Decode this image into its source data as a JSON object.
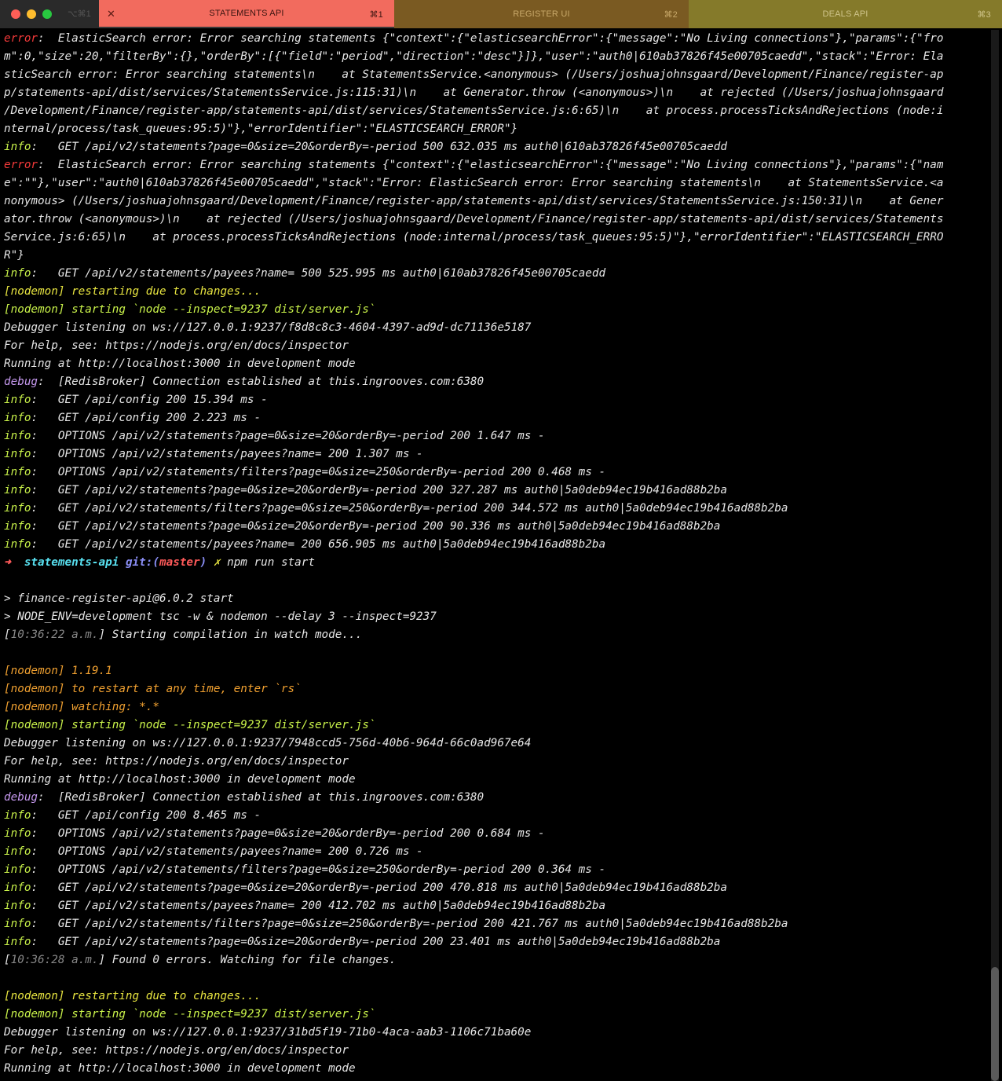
{
  "window": {
    "ghost_label": "⌥⌘1"
  },
  "tabs": [
    {
      "label": "STATEMENTS API",
      "shortcut": "⌘1",
      "active": true
    },
    {
      "label": "REGISTER UI",
      "shortcut": "⌘2",
      "active": false
    },
    {
      "label": "DEALS API",
      "shortcut": "⌘3",
      "active": false
    }
  ],
  "colors": {
    "tab1": "#f26b5e",
    "tab2": "#7a5a22",
    "tab3": "#857a2a",
    "info": "#c9f24a",
    "error": "#f53a3a",
    "debug": "#c79af0",
    "nodemon": "#e8e540"
  },
  "lines": [
    [
      [
        "r",
        "error"
      ],
      [
        "w",
        ":  ElasticSearch error: Error searching statements {\"context\":{\"elasticsearchError\":{\"message\":\"No Living connections\"},\"params\":{\"fro"
      ]
    ],
    [
      [
        "w",
        "m\":0,\"size\":20,\"filterBy\":{},\"orderBy\":[{\"field\":\"period\",\"direction\":\"desc\"}]},\"user\":\"auth0|610ab37826f45e00705caedd\",\"stack\":\"Error: Ela"
      ]
    ],
    [
      [
        "w",
        "sticSearch error: Error searching statements\\n    at StatementsService.<anonymous> (/Users/joshuajohnsgaard/Development/Finance/register-ap"
      ]
    ],
    [
      [
        "w",
        "p/statements-api/dist/services/StatementsService.js:115:31)\\n    at Generator.throw (<anonymous>)\\n    at rejected (/Users/joshuajohnsgaard"
      ]
    ],
    [
      [
        "w",
        "/Development/Finance/register-app/statements-api/dist/services/StatementsService.js:6:65)\\n    at process.processTicksAndRejections (node:i"
      ]
    ],
    [
      [
        "w",
        "nternal/process/task_queues:95:5)\"},\"errorIdentifier\":\"ELASTICSEARCH_ERROR\"}"
      ]
    ],
    [
      [
        "g",
        "info"
      ],
      [
        "w",
        ":   GET /api/v2/statements?page=0&size=20&orderBy=-period 500 632.035 ms auth0|610ab37826f45e00705caedd"
      ]
    ],
    [
      [
        "r",
        "error"
      ],
      [
        "w",
        ":  ElasticSearch error: Error searching statements {\"context\":{\"elasticsearchError\":{\"message\":\"No Living connections\"},\"params\":{\"nam"
      ]
    ],
    [
      [
        "w",
        "e\":\"\"},\"user\":\"auth0|610ab37826f45e00705caedd\",\"stack\":\"Error: ElasticSearch error: Error searching statements\\n    at StatementsService.<a"
      ]
    ],
    [
      [
        "w",
        "nonymous> (/Users/joshuajohnsgaard/Development/Finance/register-app/statements-api/dist/services/StatementsService.js:150:31)\\n    at Gener"
      ]
    ],
    [
      [
        "w",
        "ator.throw (<anonymous>)\\n    at rejected (/Users/joshuajohnsgaard/Development/Finance/register-app/statements-api/dist/services/Statements"
      ]
    ],
    [
      [
        "w",
        "Service.js:6:65)\\n    at process.processTicksAndRejections (node:internal/process/task_queues:95:5)\"},\"errorIdentifier\":\"ELASTICSEARCH_ERRO"
      ]
    ],
    [
      [
        "w",
        "R\"}"
      ]
    ],
    [
      [
        "g",
        "info"
      ],
      [
        "w",
        ":   GET /api/v2/statements/payees?name= 500 525.995 ms auth0|610ab37826f45e00705caedd"
      ]
    ],
    [
      [
        "y",
        "[nodemon] restarting due to changes..."
      ]
    ],
    [
      [
        "g",
        "[nodemon] starting `node --inspect=9237 dist/server.js`"
      ]
    ],
    [
      [
        "w",
        "Debugger listening on ws://127.0.0.1:9237/f8d8c8c3-4604-4397-ad9d-dc71136e5187"
      ]
    ],
    [
      [
        "w",
        "For help, see: https://nodejs.org/en/docs/inspector"
      ]
    ],
    [
      [
        "w",
        "Running at http://localhost:3000 in development mode"
      ]
    ],
    [
      [
        "m",
        "debug"
      ],
      [
        "w",
        ":  [RedisBroker] Connection established at this.ingrooves.com:6380"
      ]
    ],
    [
      [
        "g",
        "info"
      ],
      [
        "w",
        ":   GET /api/config 200 15.394 ms -"
      ]
    ],
    [
      [
        "g",
        "info"
      ],
      [
        "w",
        ":   GET /api/config 200 2.223 ms -"
      ]
    ],
    [
      [
        "g",
        "info"
      ],
      [
        "w",
        ":   OPTIONS /api/v2/statements?page=0&size=20&orderBy=-period 200 1.647 ms -"
      ]
    ],
    [
      [
        "g",
        "info"
      ],
      [
        "w",
        ":   OPTIONS /api/v2/statements/payees?name= 200 1.307 ms -"
      ]
    ],
    [
      [
        "g",
        "info"
      ],
      [
        "w",
        ":   OPTIONS /api/v2/statements/filters?page=0&size=250&orderBy=-period 200 0.468 ms -"
      ]
    ],
    [
      [
        "g",
        "info"
      ],
      [
        "w",
        ":   GET /api/v2/statements?page=0&size=20&orderBy=-period 200 327.287 ms auth0|5a0deb94ec19b416ad88b2ba"
      ]
    ],
    [
      [
        "g",
        "info"
      ],
      [
        "w",
        ":   GET /api/v2/statements/filters?page=0&size=250&orderBy=-period 200 344.572 ms auth0|5a0deb94ec19b416ad88b2ba"
      ]
    ],
    [
      [
        "g",
        "info"
      ],
      [
        "w",
        ":   GET /api/v2/statements?page=0&size=20&orderBy=-period 200 90.336 ms auth0|5a0deb94ec19b416ad88b2ba"
      ]
    ],
    [
      [
        "g",
        "info"
      ],
      [
        "w",
        ":   GET /api/v2/statements/payees?name= 200 656.905 ms auth0|5a0deb94ec19b416ad88b2ba"
      ]
    ],
    [
      [
        "rb",
        "➜ "
      ],
      [
        "c",
        " statements-api "
      ],
      [
        "mb",
        "git:("
      ],
      [
        "rb",
        "master"
      ],
      [
        "mb",
        ")"
      ],
      [
        "y",
        " ✗"
      ],
      [
        "w",
        " npm run start"
      ]
    ],
    [
      [
        "w",
        ""
      ]
    ],
    [
      [
        "w",
        "> finance-register-api@6.0.2 start"
      ]
    ],
    [
      [
        "w",
        "> NODE_ENV=development tsc -w & nodemon --delay 3 --inspect=9237"
      ]
    ],
    [
      [
        "w",
        "["
      ],
      [
        "gr",
        "10:36:22 a.m."
      ],
      [
        "w",
        "] Starting compilation in watch mode..."
      ]
    ],
    [
      [
        "w",
        ""
      ]
    ],
    [
      [
        "o",
        "[nodemon] 1.19.1"
      ]
    ],
    [
      [
        "o",
        "[nodemon] to restart at any time, enter `rs`"
      ]
    ],
    [
      [
        "o",
        "[nodemon] watching: *.*"
      ]
    ],
    [
      [
        "g",
        "[nodemon] starting `node --inspect=9237 dist/server.js`"
      ]
    ],
    [
      [
        "w",
        "Debugger listening on ws://127.0.0.1:9237/7948ccd5-756d-40b6-964d-66c0ad967e64"
      ]
    ],
    [
      [
        "w",
        "For help, see: https://nodejs.org/en/docs/inspector"
      ]
    ],
    [
      [
        "w",
        "Running at http://localhost:3000 in development mode"
      ]
    ],
    [
      [
        "m",
        "debug"
      ],
      [
        "w",
        ":  [RedisBroker] Connection established at this.ingrooves.com:6380"
      ]
    ],
    [
      [
        "g",
        "info"
      ],
      [
        "w",
        ":   GET /api/config 200 8.465 ms -"
      ]
    ],
    [
      [
        "g",
        "info"
      ],
      [
        "w",
        ":   OPTIONS /api/v2/statements?page=0&size=20&orderBy=-period 200 0.684 ms -"
      ]
    ],
    [
      [
        "g",
        "info"
      ],
      [
        "w",
        ":   OPTIONS /api/v2/statements/payees?name= 200 0.726 ms -"
      ]
    ],
    [
      [
        "g",
        "info"
      ],
      [
        "w",
        ":   OPTIONS /api/v2/statements/filters?page=0&size=250&orderBy=-period 200 0.364 ms -"
      ]
    ],
    [
      [
        "g",
        "info"
      ],
      [
        "w",
        ":   GET /api/v2/statements?page=0&size=20&orderBy=-period 200 470.818 ms auth0|5a0deb94ec19b416ad88b2ba"
      ]
    ],
    [
      [
        "g",
        "info"
      ],
      [
        "w",
        ":   GET /api/v2/statements/payees?name= 200 412.702 ms auth0|5a0deb94ec19b416ad88b2ba"
      ]
    ],
    [
      [
        "g",
        "info"
      ],
      [
        "w",
        ":   GET /api/v2/statements/filters?page=0&size=250&orderBy=-period 200 421.767 ms auth0|5a0deb94ec19b416ad88b2ba"
      ]
    ],
    [
      [
        "g",
        "info"
      ],
      [
        "w",
        ":   GET /api/v2/statements?page=0&size=20&orderBy=-period 200 23.401 ms auth0|5a0deb94ec19b416ad88b2ba"
      ]
    ],
    [
      [
        "w",
        "["
      ],
      [
        "gr",
        "10:36:28 a.m."
      ],
      [
        "w",
        "] Found 0 errors. Watching for file changes."
      ]
    ],
    [
      [
        "w",
        ""
      ]
    ],
    [
      [
        "y",
        "[nodemon] restarting due to changes..."
      ]
    ],
    [
      [
        "g",
        "[nodemon] starting `node --inspect=9237 dist/server.js`"
      ]
    ],
    [
      [
        "w",
        "Debugger listening on ws://127.0.0.1:9237/31bd5f19-71b0-4aca-aab3-1106c71ba60e"
      ]
    ],
    [
      [
        "w",
        "For help, see: https://nodejs.org/en/docs/inspector"
      ]
    ],
    [
      [
        "w",
        "Running at http://localhost:3000 in development mode"
      ]
    ]
  ]
}
